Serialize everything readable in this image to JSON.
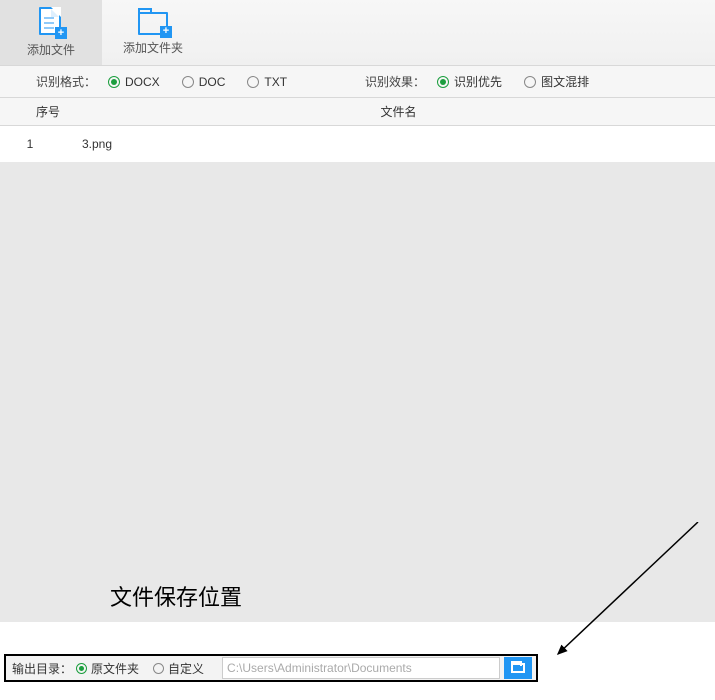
{
  "toolbar": {
    "add_file_label": "添加文件",
    "add_folder_label": "添加文件夹"
  },
  "options": {
    "format_label": "识别格式：",
    "format_docx": "DOCX",
    "format_doc": "DOC",
    "format_txt": "TXT",
    "format_selected": "DOCX",
    "effect_label": "识别效果：",
    "effect_priority": "识别优先",
    "effect_mixed": "图文混排",
    "effect_selected": "识别优先"
  },
  "columns": {
    "seq": "序号",
    "filename": "文件名"
  },
  "files": [
    {
      "seq": "1",
      "name": "3.png"
    }
  ],
  "annotation": "文件保存位置",
  "output": {
    "label": "输出目录：",
    "opt_original": "原文件夹",
    "opt_custom": "自定义",
    "selected": "原文件夹",
    "path": "C:\\Users\\Administrator\\Documents"
  }
}
